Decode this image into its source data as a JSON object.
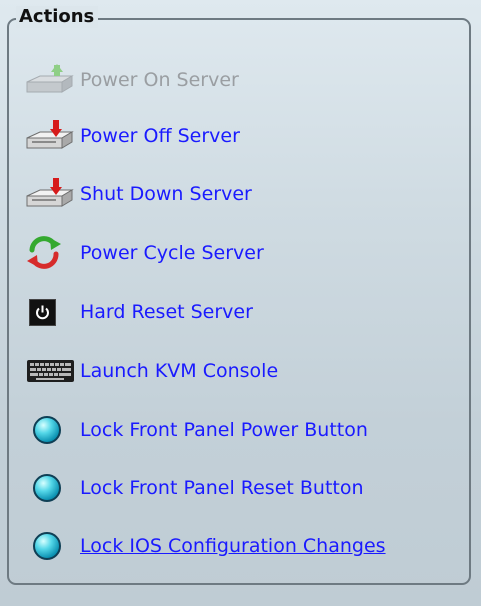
{
  "actions_panel": {
    "title": "Actions",
    "items": [
      {
        "label": "Power On Server",
        "icon": "server-power-on-icon",
        "enabled": false
      },
      {
        "label": "Power Off Server",
        "icon": "server-power-off-icon",
        "enabled": true
      },
      {
        "label": "Shut Down Server",
        "icon": "server-shutdown-icon",
        "enabled": true
      },
      {
        "label": "Power Cycle Server",
        "icon": "power-cycle-icon",
        "enabled": true
      },
      {
        "label": "Hard Reset Server",
        "icon": "power-button-icon",
        "enabled": true
      },
      {
        "label": "Launch KVM Console",
        "icon": "keyboard-icon",
        "enabled": true
      },
      {
        "label": "Lock Front Panel Power Button",
        "icon": "status-ball-icon",
        "enabled": true
      },
      {
        "label": "Lock Front Panel Reset Button",
        "icon": "status-ball-icon",
        "enabled": true
      },
      {
        "label": "Lock IOS Configuration Changes",
        "icon": "status-ball-icon",
        "enabled": true
      }
    ]
  },
  "colors": {
    "link": "#1a1aff",
    "disabled": "#9a9ea2",
    "panel_border": "#6e7a82"
  }
}
